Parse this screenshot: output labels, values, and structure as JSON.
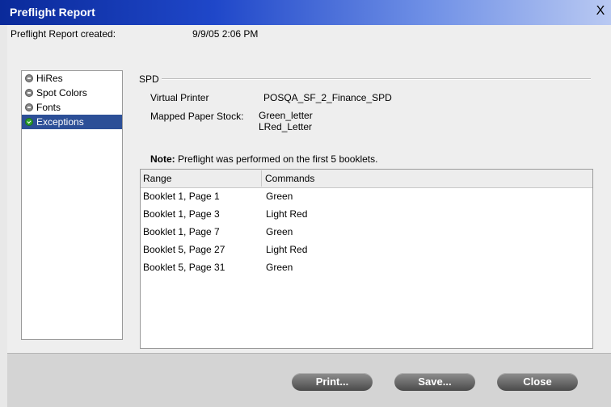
{
  "window": {
    "title": "Preflight Report",
    "close_glyph": "X"
  },
  "header": {
    "created_label": "Preflight Report created:",
    "created_value": "9/9/05 2:06 PM"
  },
  "sidebar": {
    "items": [
      {
        "label": "HiRes",
        "icon": "minus-circle-icon",
        "selected": false
      },
      {
        "label": "Spot Colors",
        "icon": "minus-circle-icon",
        "selected": false
      },
      {
        "label": "Fonts",
        "icon": "minus-circle-icon",
        "selected": false
      },
      {
        "label": "Exceptions",
        "icon": "check-circle-icon",
        "selected": true
      }
    ]
  },
  "section": {
    "title": "SPD",
    "virtual_printer_label": "Virtual Printer",
    "virtual_printer_value": "POSQA_SF_2_Finance_SPD",
    "mapped_paper_label": "Mapped Paper Stock:",
    "mapped_paper_values": [
      "Green_letter",
      "LRed_Letter"
    ]
  },
  "note": {
    "label": "Note:",
    "text": "Preflight was performed on the first 5 booklets."
  },
  "table": {
    "columns": [
      "Range",
      "Commands"
    ],
    "rows": [
      [
        "Booklet 1, Page 1",
        "Green"
      ],
      [
        "Booklet 1, Page 3",
        "Light Red"
      ],
      [
        "Booklet 1, Page 7",
        "Green"
      ],
      [
        "Booklet 5, Page 27",
        "Light Red"
      ],
      [
        "Booklet 5, Page 31",
        "Green"
      ]
    ]
  },
  "buttons": {
    "print": "Print...",
    "save": "Save...",
    "close": "Close"
  },
  "colors": {
    "selection": "#2c4f97",
    "title_bar": "#1f47c9",
    "ok_icon": "#2ea02e"
  }
}
